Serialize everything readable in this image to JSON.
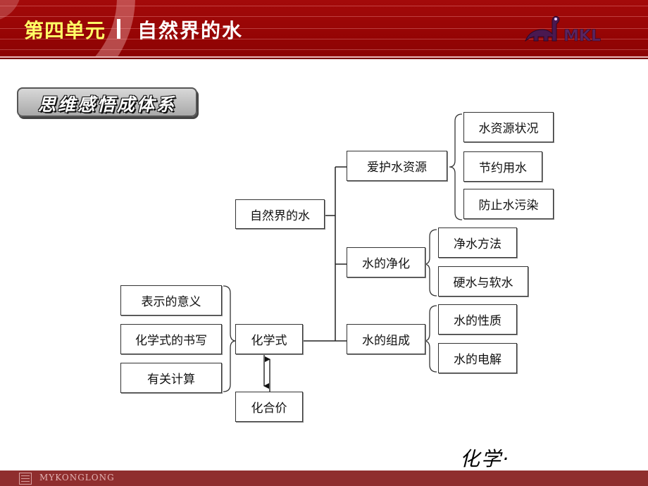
{
  "header": {
    "unit_label": "第四单元",
    "topic_label": "自然界的水",
    "logo_text": "MKL"
  },
  "section_badge": "思维感悟成体系",
  "diagram": {
    "root": "自然界的水",
    "branches": [
      {
        "label": "爱护水资源",
        "children": [
          "水资源状况",
          "节约用水",
          "防止水污染"
        ]
      },
      {
        "label": "水的净化",
        "children": [
          "净水方法",
          "硬水与软水"
        ]
      },
      {
        "label": "水的组成",
        "children": [
          "水的性质",
          "水的电解"
        ]
      }
    ],
    "formula_node": {
      "label": "化学式",
      "aspects": [
        "表示的意义",
        "化学式的书写",
        "有关计算"
      ],
      "related": "化合价"
    }
  },
  "subject_label": "化学·",
  "footer": {
    "brand": "MYKONGLONG"
  }
}
